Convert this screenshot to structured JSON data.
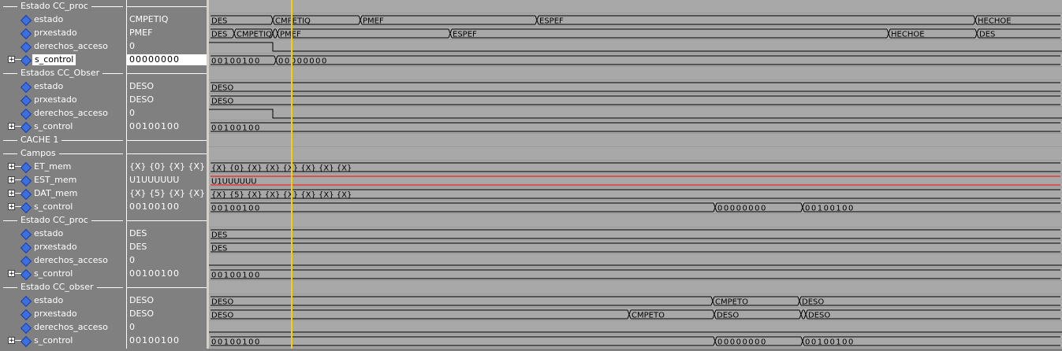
{
  "colors": {
    "cursor": "#ffcc00",
    "wave": "#000000",
    "bus_x": "#ff0000",
    "signal_icon": "#3c6fe0"
  },
  "cursor_time": 370,
  "rows": [
    {
      "kind": "group",
      "label": "Estado CC_proc"
    },
    {
      "kind": "signal",
      "name": "estado",
      "value": "CMPETIQ",
      "wave": {
        "type": "bus",
        "segments": [
          [
            265,
            "DES"
          ],
          [
            346,
            "CMPETIQ"
          ],
          [
            457,
            "PMEF"
          ],
          [
            681,
            "ESPEF"
          ],
          [
            1237,
            "HECHOE"
          ]
        ]
      }
    },
    {
      "kind": "signal",
      "name": "prxestado",
      "value": "PMEF",
      "wave": {
        "type": "bus",
        "segments": [
          [
            265,
            "DES"
          ],
          [
            297,
            "CMPETIQ"
          ],
          [
            346,
            ""
          ],
          [
            352,
            "PMEF"
          ],
          [
            571,
            "ESPEF"
          ],
          [
            1127,
            "HECHOE"
          ],
          [
            1239,
            "DES"
          ]
        ]
      }
    },
    {
      "kind": "signal",
      "name": "derechos_acceso",
      "value": "0",
      "wave": {
        "type": "bit",
        "edges": [
          [
            265,
            1
          ],
          [
            346,
            0
          ]
        ]
      }
    },
    {
      "kind": "signal",
      "name": "s_control",
      "value": "00000000",
      "expand": true,
      "selected": true,
      "wave": {
        "type": "bus",
        "segments": [
          [
            265,
            "00100100"
          ],
          [
            350,
            "00000000"
          ]
        ]
      }
    },
    {
      "kind": "group",
      "label": "Estados CC_Obser"
    },
    {
      "kind": "signal",
      "name": "estado",
      "value": "DESO",
      "wave": {
        "type": "bus",
        "segments": [
          [
            265,
            "DESO"
          ]
        ]
      }
    },
    {
      "kind": "signal",
      "name": "prxestado",
      "value": "DESO",
      "wave": {
        "type": "bus",
        "segments": [
          [
            265,
            "DESO"
          ]
        ]
      }
    },
    {
      "kind": "signal",
      "name": "derechos_acceso",
      "value": "0",
      "wave": {
        "type": "bit",
        "edges": [
          [
            265,
            1
          ],
          [
            346,
            0
          ]
        ]
      }
    },
    {
      "kind": "signal",
      "name": "s_control",
      "value": "00100100",
      "expand": true,
      "wave": {
        "type": "bus",
        "segments": [
          [
            265,
            "00100100"
          ]
        ]
      }
    },
    {
      "kind": "group",
      "label": "CACHE 1"
    },
    {
      "kind": "group",
      "label": "Campos"
    },
    {
      "kind": "signal",
      "name": "ET_mem",
      "value": "{X} {0} {X} {X} {...",
      "expand": true,
      "wave": {
        "type": "bus",
        "segments": [
          [
            265,
            "{X} {0} {X} {X} {X} {X} {X} {X}"
          ]
        ]
      }
    },
    {
      "kind": "signal",
      "name": "EST_mem",
      "value": "U1UUUUUU",
      "expand": true,
      "wave": {
        "type": "busx",
        "segments": [
          [
            265,
            "U1UUUUUU"
          ]
        ]
      }
    },
    {
      "kind": "signal",
      "name": "DAT_mem",
      "value": "{X} {5} {X} {X} {...",
      "expand": true,
      "wave": {
        "type": "bus",
        "segments": [
          [
            265,
            "{X} {5} {X} {X} {X} {X} {X} {X}"
          ]
        ]
      }
    },
    {
      "kind": "signal",
      "name": "s_control",
      "value": "00100100",
      "expand": true,
      "wave": {
        "type": "bus",
        "segments": [
          [
            265,
            "00100100"
          ],
          [
            907,
            "00000000"
          ],
          [
            1018,
            "00100100"
          ]
        ]
      }
    },
    {
      "kind": "group",
      "label": "Estado CC_proc"
    },
    {
      "kind": "signal",
      "name": "estado",
      "value": "DES",
      "wave": {
        "type": "bus",
        "segments": [
          [
            265,
            "DES"
          ]
        ]
      }
    },
    {
      "kind": "signal",
      "name": "prxestado",
      "value": "DES",
      "wave": {
        "type": "bus",
        "segments": [
          [
            265,
            "DES"
          ]
        ]
      }
    },
    {
      "kind": "signal",
      "name": "derechos_acceso",
      "value": "0",
      "wave": {
        "type": "bit",
        "edges": [
          [
            265,
            0
          ]
        ]
      }
    },
    {
      "kind": "signal",
      "name": "s_control",
      "value": "00100100",
      "expand": true,
      "wave": {
        "type": "bus",
        "segments": [
          [
            265,
            "00100100"
          ]
        ]
      }
    },
    {
      "kind": "group",
      "label": "Estado CC_obser"
    },
    {
      "kind": "signal",
      "name": "estado",
      "value": "DESO",
      "wave": {
        "type": "bus",
        "segments": [
          [
            265,
            "DESO"
          ],
          [
            904,
            "CMPETO"
          ],
          [
            1014,
            "DESO"
          ]
        ]
      }
    },
    {
      "kind": "signal",
      "name": "prxestado",
      "value": "DESO",
      "wave": {
        "type": "bus",
        "segments": [
          [
            265,
            "DESO"
          ],
          [
            798,
            "CMPETO"
          ],
          [
            906,
            "DESO"
          ],
          [
            1016,
            ""
          ],
          [
            1022,
            "DESO"
          ]
        ]
      }
    },
    {
      "kind": "signal",
      "name": "derechos_acceso",
      "value": "0",
      "wave": {
        "type": "bit",
        "edges": [
          [
            265,
            0
          ]
        ]
      }
    },
    {
      "kind": "signal",
      "name": "s_control",
      "value": "00100100",
      "expand": true,
      "wave": {
        "type": "bus",
        "segments": [
          [
            265,
            "00100100"
          ],
          [
            907,
            "00000000"
          ],
          [
            1018,
            "00100100"
          ]
        ]
      }
    }
  ]
}
